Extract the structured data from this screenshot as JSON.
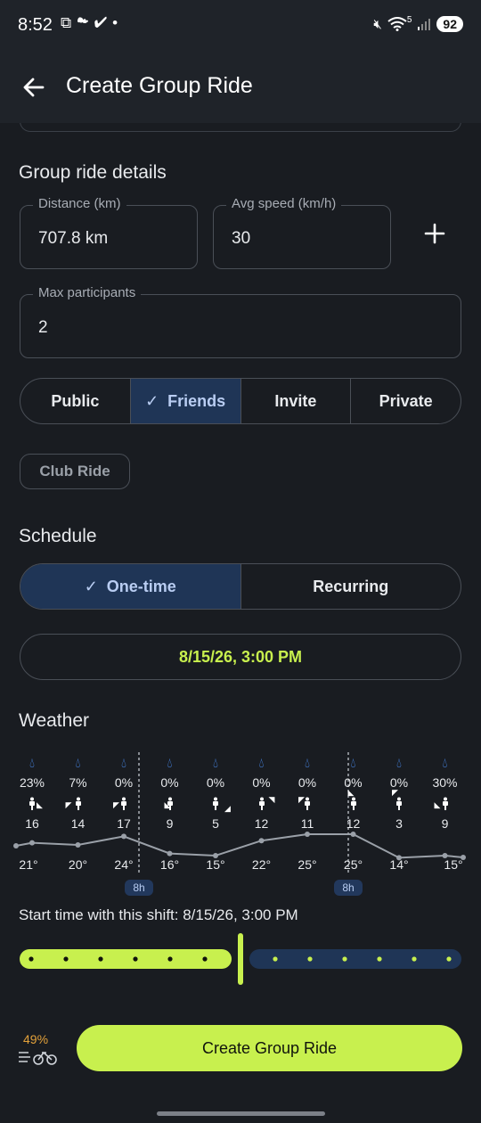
{
  "status_bar": {
    "time": "8:52",
    "battery": "92",
    "left_icons": [
      "screenshot-icon",
      "cloud-icon",
      "check-icon",
      "dot"
    ],
    "right_icons": [
      "mute-icon",
      "wifi-icon",
      "signal-icon"
    ],
    "wifi_label": "5"
  },
  "app_bar": {
    "title": "Create Group Ride"
  },
  "details": {
    "section_title": "Group ride details",
    "distance_label": "Distance (km)",
    "distance_value": "707.8 km",
    "speed_label": "Avg speed (km/h)",
    "speed_value": "30",
    "max_participants_label": "Max participants",
    "max_participants_value": "2"
  },
  "visibility": {
    "options": [
      "Public",
      "Friends",
      "Invite",
      "Private"
    ],
    "selected": "Friends"
  },
  "chip": {
    "label": "Club Ride"
  },
  "schedule": {
    "section_title": "Schedule",
    "options": [
      "One-time",
      "Recurring"
    ],
    "selected": "One-time",
    "datetime": "8/15/26, 3:00 PM"
  },
  "weather": {
    "section_title": "Weather",
    "hours": [
      {
        "precip": "23%",
        "wind": "16",
        "temp": "21°",
        "temp_value": 21
      },
      {
        "precip": "7%",
        "wind": "14",
        "temp": "20°",
        "temp_value": 20
      },
      {
        "precip": "0%",
        "wind": "17",
        "temp": "24°",
        "temp_value": 24
      },
      {
        "precip": "0%",
        "wind": "9",
        "temp": "16°",
        "temp_value": 16
      },
      {
        "precip": "0%",
        "wind": "5",
        "temp": "15°",
        "temp_value": 15
      },
      {
        "precip": "0%",
        "wind": "12",
        "temp": "22°",
        "temp_value": 22
      },
      {
        "precip": "0%",
        "wind": "11",
        "temp": "25°",
        "temp_value": 25
      },
      {
        "precip": "0%",
        "wind": "12",
        "temp": "25°",
        "temp_value": 25
      },
      {
        "precip": "0%",
        "wind": "3",
        "temp": "14°",
        "temp_value": 14
      },
      {
        "precip": "30%",
        "wind": "9",
        "temp": "15°",
        "temp_value": 15
      }
    ],
    "hour_badges": [
      "8h",
      "8h"
    ]
  },
  "shift": {
    "text": "Start time with this shift: 8/15/26, 3:00 PM",
    "position": 0.5
  },
  "bottom": {
    "battery_percent": "49%",
    "create_label": "Create Group Ride"
  },
  "colors": {
    "accent": "#c8f04e",
    "selected_bg": "#1f3556",
    "rain": "#4a8cf0",
    "warning": "#e3a13a"
  }
}
